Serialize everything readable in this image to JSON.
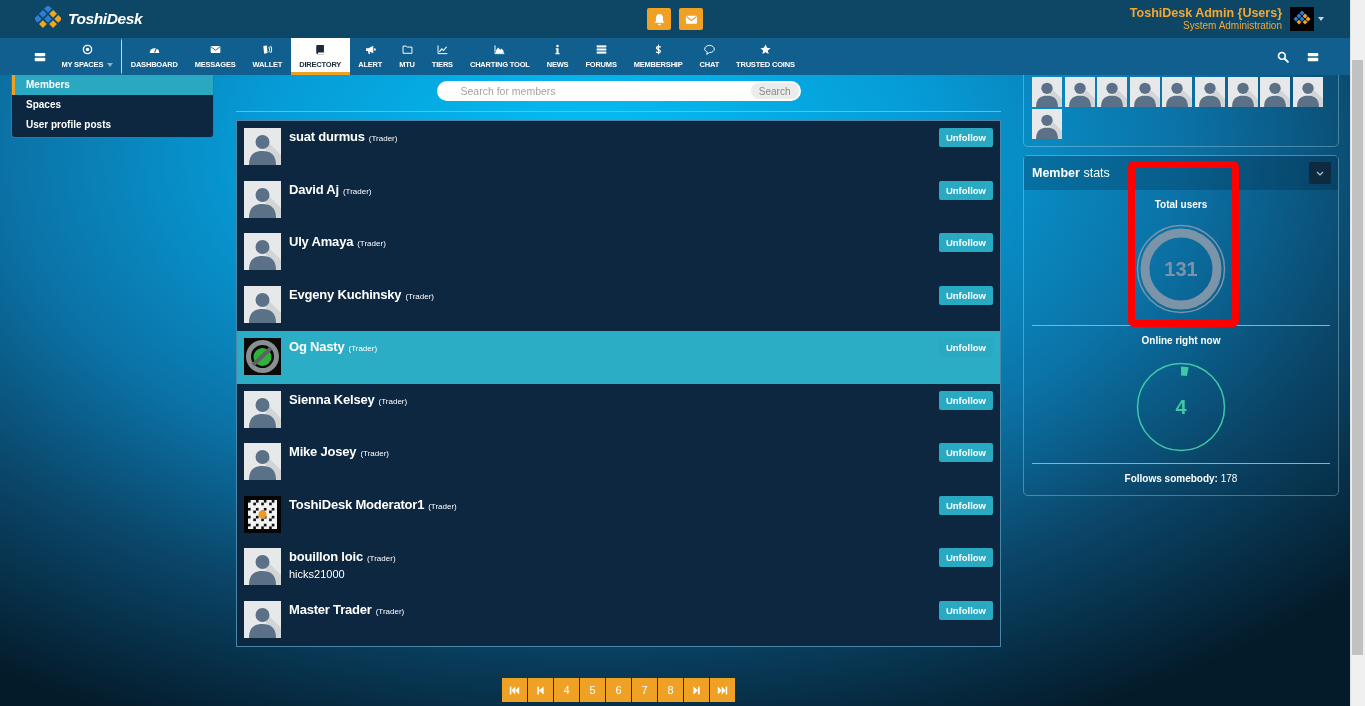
{
  "header": {
    "brand": "ToshiDesk",
    "user_name": "ToshiDesk Admin {Users}",
    "user_role": "System Administration"
  },
  "nav": {
    "items": [
      {
        "kind": "menu",
        "selected": false
      },
      {
        "kind": "dropdown",
        "label": "MY SPACES",
        "selected": false
      },
      {
        "kind": "link",
        "label": "DASHBOARD",
        "selected": false
      },
      {
        "kind": "link",
        "label": "MESSAGES",
        "selected": false
      },
      {
        "kind": "link",
        "label": "WALLET",
        "selected": false
      },
      {
        "kind": "link",
        "label": "DIRECTORY",
        "selected": true
      },
      {
        "kind": "link",
        "label": "ALERT",
        "selected": false
      },
      {
        "kind": "link",
        "label": "MTU",
        "selected": false
      },
      {
        "kind": "link",
        "label": "TIERS",
        "selected": false
      },
      {
        "kind": "link",
        "label": "CHARTING TOOL",
        "selected": false
      },
      {
        "kind": "link",
        "label": "NEWS",
        "selected": false
      },
      {
        "kind": "link",
        "label": "FORUMS",
        "selected": false
      },
      {
        "kind": "link",
        "label": "MEMBERSHIP",
        "selected": false
      },
      {
        "kind": "link",
        "label": "CHAT",
        "selected": false
      },
      {
        "kind": "link",
        "label": "TRUSTED COINS",
        "selected": false
      }
    ]
  },
  "sidebar": {
    "items": [
      {
        "label": "Members",
        "selected": true
      },
      {
        "label": "Spaces",
        "selected": false
      },
      {
        "label": "User profile posts",
        "selected": false
      }
    ]
  },
  "search": {
    "placeholder": "Search for members",
    "button": "Search"
  },
  "members": [
    {
      "name": "suat durmus",
      "role": "(Trader)",
      "kind": "silhouette",
      "selected": false,
      "button": "Unfollow"
    },
    {
      "name": "David Aj",
      "role": "(Trader)",
      "kind": "silhouette",
      "selected": false,
      "button": "Unfollow"
    },
    {
      "name": "Uly Amaya",
      "role": "(Trader)",
      "kind": "silhouette",
      "selected": false,
      "button": "Unfollow"
    },
    {
      "name": "Evgeny Kuchinsky",
      "role": "(Trader)",
      "kind": "silhouette",
      "selected": false,
      "button": "Unfollow"
    },
    {
      "name": "Og Nasty",
      "role": "(Trader)",
      "kind": "coin",
      "selected": true,
      "button": "Unfollow"
    },
    {
      "name": "Sienna Kelsey",
      "role": "(Trader)",
      "kind": "silhouette",
      "selected": false,
      "button": "Unfollow"
    },
    {
      "name": "Mike Josey",
      "role": "(Trader)",
      "kind": "silhouette",
      "selected": false,
      "button": "Unfollow"
    },
    {
      "name": "ToshiDesk Moderator1",
      "role": "(Trader)",
      "kind": "qrcode",
      "selected": false,
      "button": "Unfollow"
    },
    {
      "name": "bouillon loic",
      "role": "(Trader)",
      "kind": "silhouette",
      "selected": false,
      "button": "Unfollow",
      "bio": "hicks21000"
    },
    {
      "name": "Master Trader",
      "role": "(Trader)",
      "kind": "silhouette",
      "selected": false,
      "button": "Unfollow"
    }
  ],
  "pagination": {
    "items": [
      {
        "kind": "first"
      },
      {
        "kind": "prev"
      },
      {
        "kind": "page",
        "label": "4"
      },
      {
        "kind": "page",
        "label": "5"
      },
      {
        "kind": "page",
        "label": "6"
      },
      {
        "kind": "page",
        "label": "7"
      },
      {
        "kind": "page",
        "label": "8"
      },
      {
        "kind": "next"
      },
      {
        "kind": "last"
      }
    ]
  },
  "following": {
    "avatars": [
      {
        "kind": "silhouette"
      },
      {
        "kind": "silhouette"
      },
      {
        "kind": "silhouette"
      },
      {
        "kind": "silhouette"
      },
      {
        "kind": "silhouette"
      },
      {
        "kind": "silhouette"
      },
      {
        "kind": "silhouette"
      },
      {
        "kind": "silhouette"
      },
      {
        "kind": "silhouette"
      },
      {
        "kind": "silhouette"
      }
    ]
  },
  "member_stats": {
    "title": "**Member** stats",
    "stats": [
      {
        "label": "Total users",
        "value": "131",
        "color": "#7b94a8",
        "level": 1,
        "highlighted": true
      },
      {
        "label": "Online right now",
        "value": "4",
        "color": "#3fc8a6",
        "level": 0.03,
        "highlighted": false
      }
    ],
    "follows": "**Follows somebody:** 178"
  }
}
